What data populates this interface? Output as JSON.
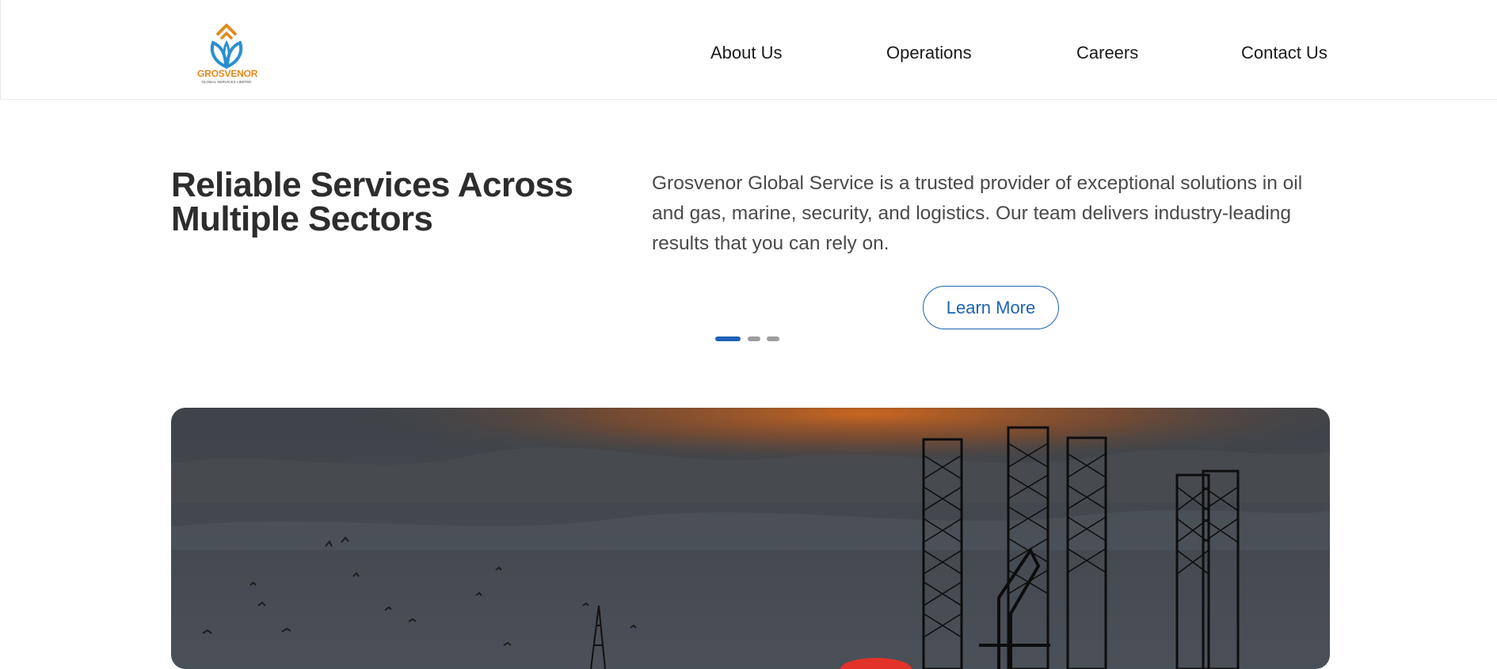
{
  "brand": {
    "name": "GROSVENOR",
    "tagline": "GLOBAL SERVICES LIMITED",
    "accent_color": "#1e62b5",
    "logo_orange": "#e08a1e",
    "logo_blue": "#2a8fd0"
  },
  "nav": {
    "items": [
      {
        "label": "About Us"
      },
      {
        "label": "Operations"
      },
      {
        "label": "Careers"
      },
      {
        "label": "Contact Us"
      }
    ]
  },
  "hero": {
    "title": "Reliable Services Across Multiple Sectors",
    "description": "Grosvenor Global Service is a trusted provider of exceptional solutions in oil and gas, marine, security, and logistics. Our team delivers industry-leading results that you can rely on.",
    "cta_label": "Learn More",
    "slides_total": 3,
    "active_slide": 1
  },
  "banner_image": {
    "subject": "offshore oil rigs silhouetted at sunset with birds in flight"
  }
}
